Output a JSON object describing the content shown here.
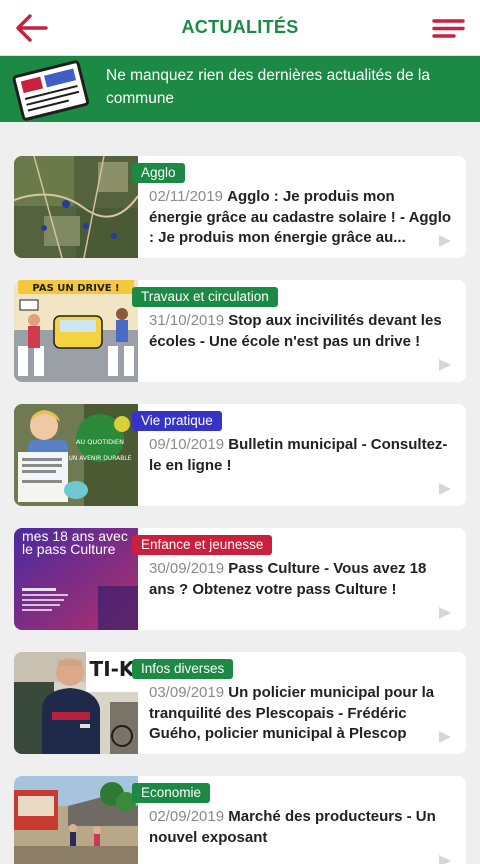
{
  "header": {
    "title": "ACTUALITÉS",
    "back_icon": "arrow-left-icon",
    "menu_icon": "menu-icon",
    "accent": "#c8203d",
    "brand": "#1c8a44"
  },
  "banner": {
    "text": "Ne manquez rien des dernières actualités de la commune",
    "icon": "newspaper-icon"
  },
  "articles": [
    {
      "category": "Agglo",
      "category_color": "#1c8a44",
      "date": "02/11/2019",
      "title": "Agglo : Je produis mon énergie grâce au cadastre solaire ! - Agglo : Je produis mon énergie grâce au..."
    },
    {
      "category": "Travaux et circulation",
      "category_color": "#1c8a44",
      "date": "31/10/2019",
      "title": "Stop aux incivilités devant les écoles - Une école n'est pas un drive !"
    },
    {
      "category": "Vie pratique",
      "category_color": "#3534c7",
      "date": "09/10/2019",
      "title": "Bulletin municipal - Consultez-le en ligne !"
    },
    {
      "category": "Enfance et jeunesse",
      "category_color": "#c8203d",
      "date": "30/09/2019",
      "title": "Pass Culture - Vous avez 18 ans ? Obtenez votre pass Culture !"
    },
    {
      "category": "Infos diverses",
      "category_color": "#1c8a44",
      "date": "03/09/2019",
      "title": "Un policier municipal pour la tranquilité des Plescopais - Frédéric Guého, policier municipal à Plescop"
    },
    {
      "category": "Economie",
      "category_color": "#1c8a44",
      "date": "02/09/2019",
      "title": "Marché des producteurs - Un nouvel exposant"
    }
  ],
  "thumbnails": {
    "pass_culture": "mes 18 ans avec le pass Culture",
    "drive_sign": "PAS UN DRIVE !",
    "bulletin_a": "AU QUOTIDIEN",
    "bulletin_b": "UN AVENIR DURABLE",
    "police_sign": "TI-K"
  }
}
